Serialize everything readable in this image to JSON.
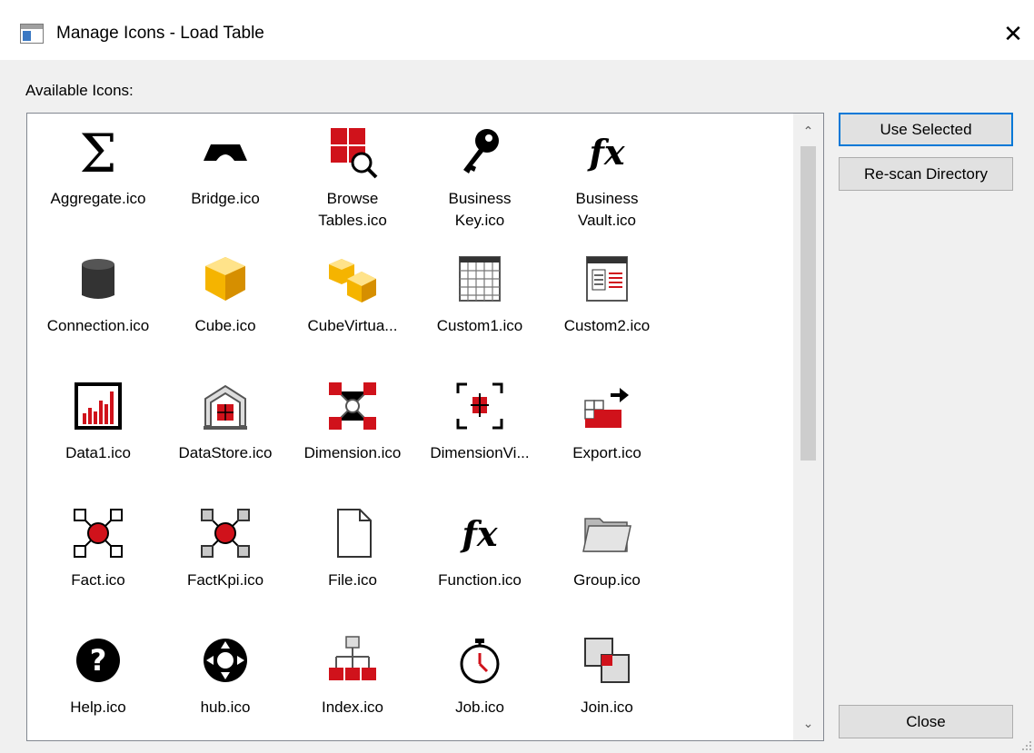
{
  "window": {
    "title": "Manage Icons - Load Table",
    "close_glyph": "✕",
    "app_icon": "window-icon"
  },
  "available_label": "Available Icons:",
  "icons": [
    {
      "label": "Aggregate.ico",
      "icon": "sigma-icon"
    },
    {
      "label": "Bridge.ico",
      "icon": "bridge-icon"
    },
    {
      "label": "Browse\nTables.ico",
      "icon": "browse-tables-icon"
    },
    {
      "label": "Business\nKey.ico",
      "icon": "key-icon"
    },
    {
      "label": "Business\nVault.ico",
      "icon": "fx-icon"
    },
    {
      "label": "Connection.ico",
      "icon": "database-icon"
    },
    {
      "label": "Cube.ico",
      "icon": "cube-icon"
    },
    {
      "label": "CubeVirtua...",
      "icon": "cube-virtual-icon"
    },
    {
      "label": "Custom1.ico",
      "icon": "grid-table-icon"
    },
    {
      "label": "Custom2.ico",
      "icon": "document-list-icon"
    },
    {
      "label": "Data1.ico",
      "icon": "bar-chart-icon"
    },
    {
      "label": "DataStore.ico",
      "icon": "datastore-icon"
    },
    {
      "label": "Dimension.ico",
      "icon": "dimension-icon"
    },
    {
      "label": "DimensionVi...",
      "icon": "dimension-view-icon"
    },
    {
      "label": "Export.ico",
      "icon": "export-icon"
    },
    {
      "label": "Fact.ico",
      "icon": "fact-icon"
    },
    {
      "label": "FactKpi.ico",
      "icon": "fact-kpi-icon"
    },
    {
      "label": "File.ico",
      "icon": "file-icon"
    },
    {
      "label": "Function.ico",
      "icon": "function-fx-icon"
    },
    {
      "label": "Group.ico",
      "icon": "folder-icon"
    },
    {
      "label": "Help.ico",
      "icon": "help-icon"
    },
    {
      "label": "hub.ico",
      "icon": "hub-icon"
    },
    {
      "label": "Index.ico",
      "icon": "hierarchy-icon"
    },
    {
      "label": "Job.ico",
      "icon": "stopwatch-icon"
    },
    {
      "label": "Join.ico",
      "icon": "join-icon"
    }
  ],
  "buttons": {
    "use_selected": "Use Selected",
    "rescan": "Re-scan Directory",
    "close": "Close"
  },
  "scrollbar": {
    "up_glyph": "⌃",
    "down_glyph": "⌄"
  },
  "colors": {
    "accent_red": "#d0121b",
    "selection_border": "#0078d7",
    "cube_gold": "#f5b400"
  }
}
